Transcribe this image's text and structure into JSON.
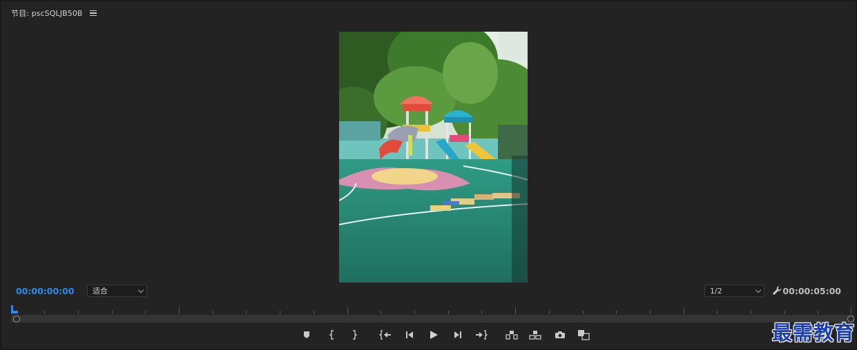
{
  "panel": {
    "title": "节目: pscSQLJB50B",
    "menu_icon": "hamburger-icon"
  },
  "viewer": {
    "content": "playground-video-frame"
  },
  "timecode": {
    "current": "00:00:00:00",
    "duration": "00:00:05:00"
  },
  "zoom": {
    "selected": "适合"
  },
  "resolution": {
    "selected": "1/2"
  },
  "settings": {
    "icon": "wrench-icon"
  },
  "transport": {
    "buttons": [
      {
        "name": "add-marker-button",
        "icon": "marker-icon"
      },
      {
        "name": "mark-in-button",
        "icon": "mark-in-icon"
      },
      {
        "name": "mark-out-button",
        "icon": "mark-out-icon"
      },
      {
        "name": "go-to-in-button",
        "icon": "go-to-in-icon"
      },
      {
        "name": "step-back-button",
        "icon": "step-back-icon"
      },
      {
        "name": "play-button",
        "icon": "play-icon"
      },
      {
        "name": "step-forward-button",
        "icon": "step-forward-icon"
      },
      {
        "name": "go-to-out-button",
        "icon": "go-to-out-icon"
      },
      {
        "name": "lift-button",
        "icon": "lift-icon"
      },
      {
        "name": "extract-button",
        "icon": "extract-icon"
      },
      {
        "name": "export-frame-button",
        "icon": "camera-icon"
      },
      {
        "name": "compare-view-button",
        "icon": "comparison-icon"
      }
    ]
  },
  "colors": {
    "accent": "#2d8ceb",
    "panel_bg": "#232323",
    "watermark": "#1d3fb3"
  },
  "watermark": {
    "text": "最需教育"
  }
}
